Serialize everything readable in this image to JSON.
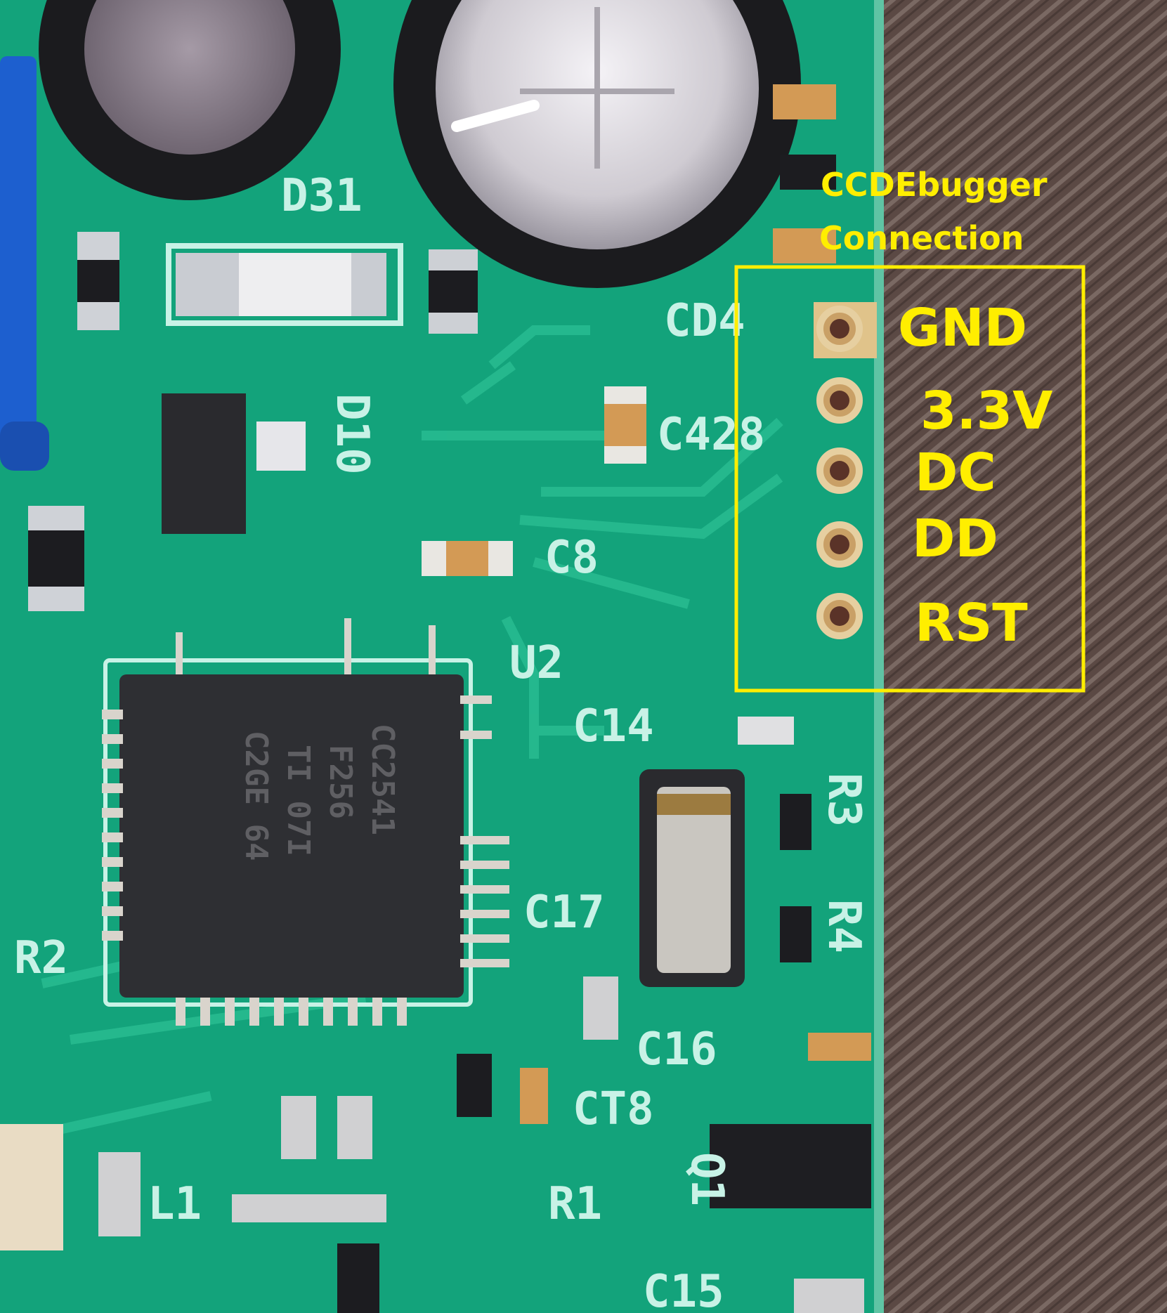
{
  "annotation": {
    "title_line1": "CCDEbugger",
    "title_line2": "Connection",
    "pins": [
      "GND",
      "3.3V",
      "DC",
      "DD",
      "RST"
    ],
    "color": "#ffee00"
  },
  "board": {
    "pcb_color": "#12a37a",
    "silkscreen_color": "#c8f2e6",
    "chip_marking": [
      "CC2541",
      "F256",
      "TI  07I",
      "C2GE  64"
    ],
    "labels": [
      "D31",
      "CD4",
      "C428",
      "D10",
      "C8",
      "U2",
      "C14",
      "R3",
      "R4",
      "C17",
      "R2",
      "C16",
      "CT8",
      "Q1",
      "R1",
      "L1",
      "C15"
    ]
  },
  "background": {
    "fabric_color": "#5a4a45"
  }
}
